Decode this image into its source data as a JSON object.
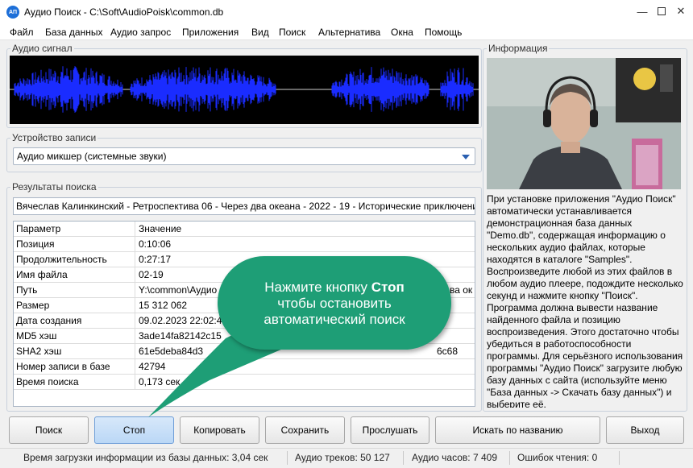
{
  "window": {
    "icon_label": "АП",
    "title": "Аудио Поиск - C:\\Soft\\AudioPoisk\\common.db"
  },
  "menu": [
    "Файл",
    "База данных",
    "Аудио запрос",
    "Приложения",
    "Вид",
    "Поиск",
    "Альтернатива",
    "Окна",
    "Помощь"
  ],
  "audio_signal": {
    "label": "Аудио сигнал"
  },
  "recording_device": {
    "label": "Устройство записи",
    "selected": "Аудио микшер (системные звуки)"
  },
  "results": {
    "label": "Результаты поиска",
    "match": "Вячеслав Калинкинский - Ретроспектива 06 - Через два океана - 2022 - 19 - Исторические приключения",
    "columns": [
      "Параметр",
      "Значение"
    ],
    "rows": [
      [
        "Позиция",
        "0:10:06"
      ],
      [
        "Продолжительность",
        "0:27:17"
      ],
      [
        "Имя файла",
        "02-19"
      ],
      [
        "Путь",
        "Y:\\common\\Аудио"
      ],
      [
        "Размер",
        "15 312 062"
      ],
      [
        "Дата создания",
        "09.02.2023 22:02:40"
      ],
      [
        "MD5 хэш",
        "3ade14fa82142c15"
      ],
      [
        "SHA2 хэш",
        "61e5deba84d3"
      ],
      [
        "Номер записи в базе",
        "42794"
      ],
      [
        "Время поиска",
        "0,173 сек"
      ]
    ],
    "path_overflow": "ва ок",
    "sha_overflow": "6c68"
  },
  "info": {
    "label": "Информация",
    "text": "При установке приложения \"Аудио Поиск\" автоматически устанавливается демонстрационная база данных \"Demo.db\", содержащая информацию о нескольких аудио файлах, которые находятся в каталоге \"Samples\". Воспроизведите любой из этих файлов в любом аудио плеере, подождите несколько секунд и нажмите кнопку \"Поиск\". Программа должна вывести название найденного файла и позицию воспроизведения. Этого достаточно чтобы убедиться в работоспособности программы. Для серьёзного использования программы \"Аудио Поиск\" загрузите любую базу данных с сайта (используйте меню \"База данных -> Скачать базу данных\") и выберите её."
  },
  "buttons": {
    "search": "Поиск",
    "stop": "Стоп",
    "copy": "Копировать",
    "save": "Сохранить",
    "listen": "Прослушать",
    "search_by_name": "Искать по названию",
    "exit": "Выход"
  },
  "status": {
    "load_time": "Время загрузки информации из базы данных: 3,04 сек",
    "tracks": "Аудио треков: 50 127",
    "hours": "Аудио часов: 7 409",
    "read_errors": "Ошибок чтения: 0"
  },
  "callout": {
    "line1_prefix": "Нажмите кнопку ",
    "line1_bold": "Стоп",
    "line2": "чтобы остановить",
    "line3": "автоматический поиск"
  },
  "colors": {
    "waveform": "#1a2cff",
    "callout": "#1e9e76",
    "accent": "#2a5fb0"
  },
  "icons": {
    "minimize": "minimize-icon",
    "maximize": "maximize-icon",
    "close": "close-icon",
    "dropdown": "chevron-down-icon"
  }
}
